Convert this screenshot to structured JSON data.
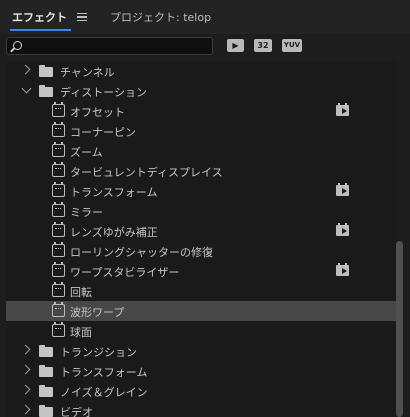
{
  "tabs": {
    "effects": "エフェクト",
    "project": "プロジェクト: telop"
  },
  "search": {
    "placeholder": "",
    "value": ""
  },
  "filters": {
    "accelerated_icon": "accelerated-effects-icon",
    "bit32": "32",
    "yuv": "YUV"
  },
  "tree": [
    {
      "type": "folder",
      "expanded": false,
      "label": "チャンネル"
    },
    {
      "type": "folder",
      "expanded": true,
      "label": "ディストーション"
    },
    {
      "type": "effect",
      "label": "オフセット",
      "accelerated": true
    },
    {
      "type": "effect",
      "label": "コーナーピン",
      "accelerated": false
    },
    {
      "type": "effect",
      "label": "ズーム",
      "accelerated": false
    },
    {
      "type": "effect",
      "label": "タービュレントディスプレイス",
      "accelerated": false
    },
    {
      "type": "effect",
      "label": "トランスフォーム",
      "accelerated": true
    },
    {
      "type": "effect",
      "label": "ミラー",
      "accelerated": false
    },
    {
      "type": "effect",
      "label": "レンズゆがみ補正",
      "accelerated": true
    },
    {
      "type": "effect",
      "label": "ローリングシャッターの修復",
      "accelerated": false
    },
    {
      "type": "effect",
      "label": "ワープスタビライザー",
      "accelerated": true
    },
    {
      "type": "effect",
      "label": "回転",
      "accelerated": false
    },
    {
      "type": "effect",
      "label": "波形ワープ",
      "accelerated": false,
      "selected": true
    },
    {
      "type": "effect",
      "label": "球面",
      "accelerated": false
    },
    {
      "type": "folder",
      "expanded": false,
      "label": "トランジション"
    },
    {
      "type": "folder",
      "expanded": false,
      "label": "トランスフォーム"
    },
    {
      "type": "folder",
      "expanded": false,
      "label": "ノイズ＆グレイン"
    },
    {
      "type": "folder",
      "expanded": false,
      "label": "ビデオ"
    }
  ]
}
